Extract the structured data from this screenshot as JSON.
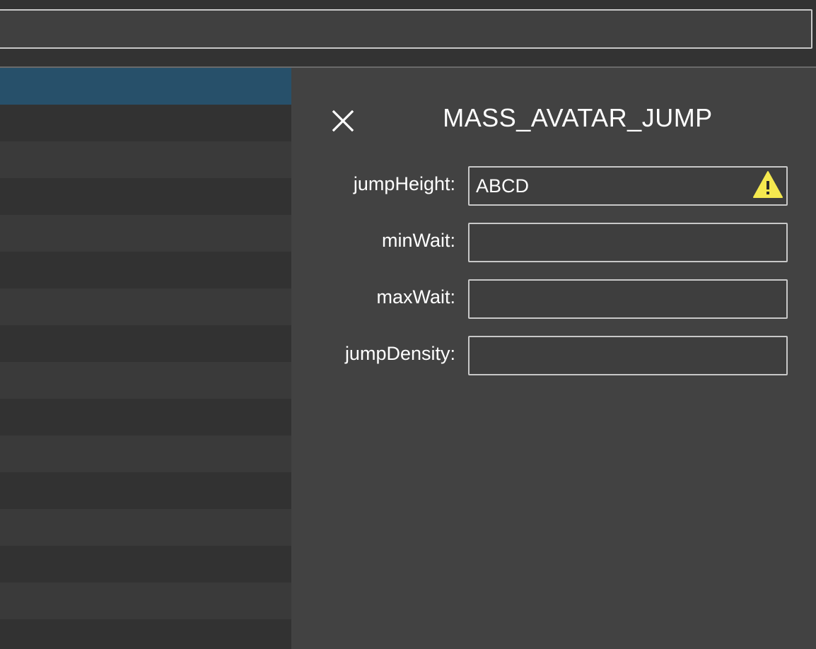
{
  "panel": {
    "title": "MASS_AVATAR_JUMP",
    "close_icon": "close-icon",
    "fields": [
      {
        "label": "jumpHeight:",
        "value": "ABCD",
        "status": "warning",
        "status_icon": "warning-icon"
      },
      {
        "label": "minWait:",
        "value": ""
      },
      {
        "label": "maxWait:",
        "value": ""
      },
      {
        "label": "jumpDensity:",
        "value": ""
      }
    ]
  },
  "colors": {
    "background": "#3b3b3b",
    "panel": "#424242",
    "selected_row": "#27506a",
    "row_dark": "#323232",
    "row_light": "#3a3a3a",
    "warning": "#f5e94f",
    "input_border": "#c8c8c8"
  },
  "list": {
    "selected_index": 0,
    "row_count": 16
  },
  "top_search": {
    "value": ""
  }
}
